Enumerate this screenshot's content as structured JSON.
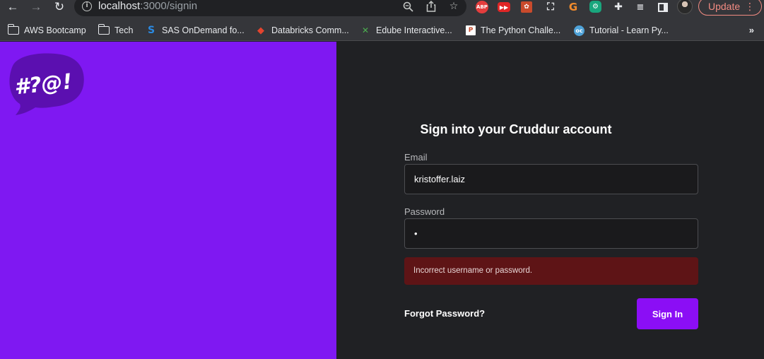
{
  "browser": {
    "url_host": "localhost",
    "url_path": ":3000/signin",
    "update_label": "Update",
    "nav": {
      "back_icon": "←",
      "forward_icon": "→",
      "reload_icon": "↻"
    },
    "extensions": [
      {
        "name": "abp",
        "label": "ABP"
      },
      {
        "name": "video",
        "label": "▶▶"
      }
    ],
    "bookmarks": [
      {
        "label": "AWS Bootcamp"
      },
      {
        "label": "Tech"
      },
      {
        "label": "SAS OnDemand fo..."
      },
      {
        "label": "Databricks Comm..."
      },
      {
        "label": "Edube Interactive..."
      },
      {
        "label": "The Python Challe..."
      },
      {
        "label": "Tutorial - Learn Py..."
      }
    ],
    "bookmarks_more": "»"
  },
  "logo": {
    "text": "#?@!",
    "color": "#5b0fb0"
  },
  "signin": {
    "title": "Sign into your Cruddur account",
    "email_label": "Email",
    "email_value": "kristoffer.laiz",
    "password_label": "Password",
    "password_value": "•",
    "error_message": "Incorrect username or password.",
    "forgot_label": "Forgot Password?",
    "submit_label": "Sign In"
  },
  "colors": {
    "left_panel": "#7f18f2",
    "right_panel": "#202124",
    "error_bg": "#5e1416",
    "button": "#8b0ef5"
  }
}
